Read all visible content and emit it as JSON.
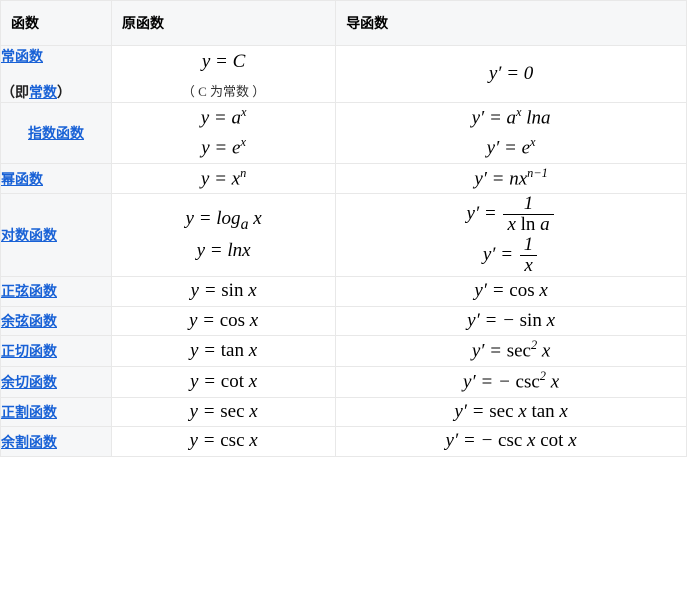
{
  "headers": {
    "c0": "函数",
    "c1": "原函数",
    "c2": "导函数"
  },
  "rows": {
    "r0": {
      "label_a": "常函数",
      "label_b": "（即",
      "label_c": "常数",
      "label_d": "）",
      "f": "y = C",
      "f_note": "（ C 为常数 ）",
      "d": "y′ = 0"
    },
    "r1": {
      "label": "指数函数",
      "f1": "y = a",
      "f1_sup": "x",
      "f2": "y = e",
      "f2_sup": "x",
      "d1": "y′ = a",
      "d1_sup": "x",
      "d1_tail": " lna",
      "d2": "y′ = e",
      "d2_sup": "x"
    },
    "r2": {
      "label": "幂函数",
      "f": "y = x",
      "f_sup": "n",
      "d": "y′ = nx",
      "d_sup": "n−1"
    },
    "r3": {
      "label": "对数函数",
      "f1_a": "y = log",
      "f1_sub": "a",
      "f1_b": " x",
      "f2": "y = lnx",
      "d1_lhs": "y′ = ",
      "d1_num": "1",
      "d1_den_a": "x ",
      "d1_den_b": "ln",
      "d1_den_c": " a",
      "d2_lhs": "y′ = ",
      "d2_num": "1",
      "d2_den": "x"
    },
    "r4": {
      "label": "正弦函数",
      "f": "y = ",
      "f_op": "sin",
      "f_b": " x",
      "d": "y′ = ",
      "d_op": "cos",
      "d_b": " x"
    },
    "r5": {
      "label": "余弦函数",
      "f": "y = ",
      "f_op": "cos",
      "f_b": " x",
      "d": "y′ = − ",
      "d_op": "sin",
      "d_b": " x"
    },
    "r6": {
      "label": "正切函数",
      "f": "y = ",
      "f_op": "tan",
      "f_b": " x",
      "d": "y′ = ",
      "d_op": "sec",
      "d_sup": "2",
      "d_b": " x"
    },
    "r7": {
      "label": "余切函数",
      "f": "y = ",
      "f_op": "cot",
      "f_b": " x",
      "d": "y′ = − ",
      "d_op": "csc",
      "d_sup": "2",
      "d_b": " x"
    },
    "r8": {
      "label": "正割函数",
      "f": "y = ",
      "f_op": "sec",
      "f_b": " x",
      "d": "y′ = ",
      "d_op": "sec",
      "d_b": " x ",
      "d_op2": "tan",
      "d_b2": " x"
    },
    "r9": {
      "label": "余割函数",
      "f": "y = ",
      "f_op": "csc",
      "f_b": " x",
      "d": "y′ = − ",
      "d_op": "csc",
      "d_b": " x ",
      "d_op2": "cot",
      "d_b2": " x"
    }
  }
}
